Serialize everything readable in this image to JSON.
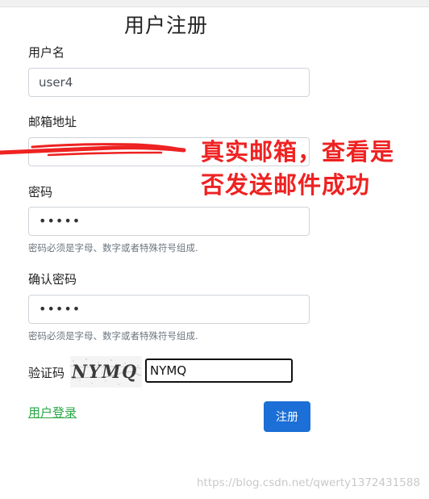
{
  "page": {
    "title": "用户注册"
  },
  "form": {
    "username": {
      "label": "用户名",
      "value": "user4"
    },
    "email": {
      "label": "邮箱地址",
      "value": ""
    },
    "password": {
      "label": "密码",
      "value": "•••••",
      "help": "密码必须是字母、数字或者特殊符号组成."
    },
    "confirm_password": {
      "label": "确认密码",
      "value": "•••••",
      "help": "密码必须是字母、数字或者特殊符号组成."
    },
    "captcha": {
      "label": "验证码",
      "image_text": "NYMQ",
      "value": "NYMQ"
    },
    "login_link": "用户登录",
    "submit_label": "注册"
  },
  "annotation": {
    "line1": "真实邮箱，查看是",
    "line2": "否发送邮件成功",
    "color": "#ee2222"
  },
  "watermark": "https://blog.csdn.net/qwerty1372431588"
}
